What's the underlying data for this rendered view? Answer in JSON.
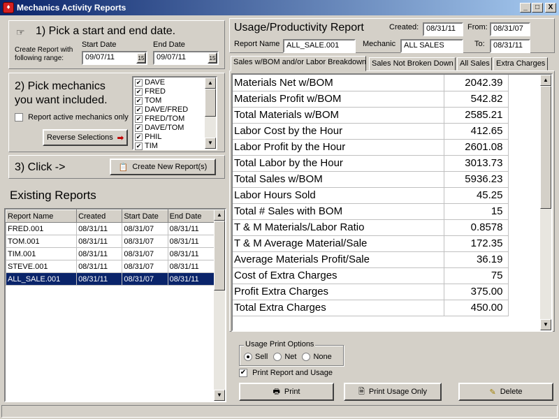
{
  "window": {
    "title": "Mechanics Activity Reports",
    "minimize": "_",
    "maximize": "□",
    "close": "X"
  },
  "step1": {
    "heading": "1) Pick a start and end date.",
    "range_label_line1": "Create Report with",
    "range_label_line2": "following range:",
    "start_label": "Start Date",
    "start_value": "09/07/11",
    "end_label": "End Date",
    "end_value": "09/07/11",
    "calendar_glyph": "15"
  },
  "step2": {
    "heading_line1": "2) Pick mechanics",
    "heading_line2": "you want included.",
    "active_only_label": "Report active mechanics only",
    "reverse_button": "Reverse Selections",
    "mechanics": [
      {
        "name": "DAVE",
        "checked": true
      },
      {
        "name": "FRED",
        "checked": true
      },
      {
        "name": "TOM",
        "checked": true
      },
      {
        "name": "DAVE/FRED",
        "checked": true
      },
      {
        "name": "FRED/TOM",
        "checked": true
      },
      {
        "name": "DAVE/TOM",
        "checked": true
      },
      {
        "name": "PHIL",
        "checked": true
      },
      {
        "name": "TIM",
        "checked": true
      }
    ]
  },
  "step3": {
    "heading": "3) Click ->",
    "create_button": "Create New Report(s)"
  },
  "existing_reports": {
    "heading": "Existing Reports",
    "columns": [
      "Report Name",
      "Created",
      "Start Date",
      "End Date"
    ],
    "rows": [
      {
        "name": "FRED.001",
        "created": "08/31/11",
        "start": "08/31/07",
        "end": "08/31/11"
      },
      {
        "name": "TOM.001",
        "created": "08/31/11",
        "start": "08/31/07",
        "end": "08/31/11"
      },
      {
        "name": "TIM.001",
        "created": "08/31/11",
        "start": "08/31/07",
        "end": "08/31/11"
      },
      {
        "name": "STEVE.001",
        "created": "08/31/11",
        "start": "08/31/07",
        "end": "08/31/11"
      },
      {
        "name": "ALL_SALE.001",
        "created": "08/31/11",
        "start": "08/31/07",
        "end": "08/31/11"
      }
    ],
    "selected_index": 4
  },
  "report": {
    "title": "Usage/Productivity Report",
    "created_label": "Created:",
    "created_value": "08/31/11",
    "from_label": "From:",
    "from_value": "08/31/07",
    "name_label": "Report Name",
    "name_value": "ALL_SALE.001",
    "mechanic_label": "Mechanic",
    "mechanic_value": "ALL SALES",
    "to_label": "To:",
    "to_value": "08/31/11"
  },
  "tabs": [
    {
      "label": "Sales w/BOM and/or Labor Breakdown",
      "active": true
    },
    {
      "label": "Sales Not Broken Down",
      "active": false
    },
    {
      "label": "All Sales",
      "active": false
    },
    {
      "label": "Extra Charges",
      "active": false
    }
  ],
  "usage_rows": [
    {
      "label": "Materials Net w/BOM",
      "value": "2042.39"
    },
    {
      "label": "Materials Profit w/BOM",
      "value": "542.82"
    },
    {
      "label": "Total Materials w/BOM",
      "value": "2585.21"
    },
    {
      "label": "Labor Cost by the Hour",
      "value": "412.65"
    },
    {
      "label": "Labor Profit by the Hour",
      "value": "2601.08"
    },
    {
      "label": "Total Labor by the Hour",
      "value": "3013.73"
    },
    {
      "label": "Total Sales w/BOM",
      "value": "5936.23"
    },
    {
      "label": "Labor Hours Sold",
      "value": "45.25"
    },
    {
      "label": "Total # Sales with BOM",
      "value": "15"
    },
    {
      "label": "T & M Materials/Labor Ratio",
      "value": "0.8578"
    },
    {
      "label": "T & M Average Material/Sale",
      "value": "172.35"
    },
    {
      "label": "Average Materials Profit/Sale",
      "value": "36.19"
    },
    {
      "label": "Cost of Extra Charges",
      "value": "75"
    },
    {
      "label": "Profit Extra Charges",
      "value": "375.00"
    },
    {
      "label": "Total Extra Charges",
      "value": "450.00"
    }
  ],
  "print_options": {
    "legend": "Usage Print Options",
    "options": [
      {
        "label": "Sell",
        "selected": true
      },
      {
        "label": "Net",
        "selected": false
      },
      {
        "label": "None",
        "selected": false
      }
    ],
    "print_report_usage_label": "Print Report and Usage",
    "print_report_usage_checked": true
  },
  "buttons": {
    "print": "Print",
    "print_usage_only": "Print Usage Only",
    "delete": "Delete"
  }
}
